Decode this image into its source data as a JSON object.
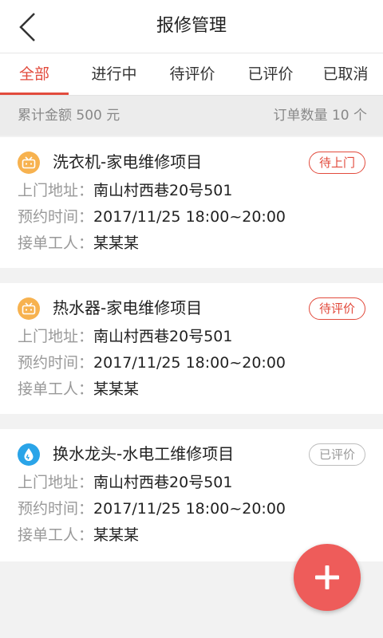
{
  "header": {
    "title": "报修管理"
  },
  "tabs": [
    {
      "label": "全部"
    },
    {
      "label": "进行中"
    },
    {
      "label": "待评价"
    },
    {
      "label": "已评价"
    },
    {
      "label": "已取消"
    }
  ],
  "summary": {
    "total_amount": "累计金额 500 元",
    "order_count": "订单数量 10 个"
  },
  "orders": [
    {
      "title": "洗衣机-家电维修项目",
      "status": "待上门",
      "icon": "tv-icon",
      "address_label": "上门地址：",
      "address": "南山村西巷20号501",
      "time_label": "预约时间：",
      "time": "2017/11/25  18:00~20:00",
      "worker_label": "接单工人：",
      "worker": "某某某"
    },
    {
      "title": "热水器-家电维修项目",
      "status": "待评价",
      "icon": "tv-icon",
      "address_label": "上门地址：",
      "address": "南山村西巷20号501",
      "time_label": "预约时间：",
      "time": "2017/11/25  18:00~20:00",
      "worker_label": "接单工人：",
      "worker": "某某某"
    },
    {
      "title": "换水龙头-水电工维修项目",
      "status": "已评价",
      "icon": "water-drop-icon",
      "address_label": "上门地址：",
      "address": "南山村西巷20号501",
      "time_label": "预约时间：",
      "time": "2017/11/25  18:00~20:00",
      "worker_label": "接单工人：",
      "worker": "某某某"
    }
  ],
  "colors": {
    "accent": "#e24b3d",
    "fab": "#ee5c5a",
    "appliance_icon": "#f7b24f",
    "plumbing_icon": "#2aa4e8"
  }
}
